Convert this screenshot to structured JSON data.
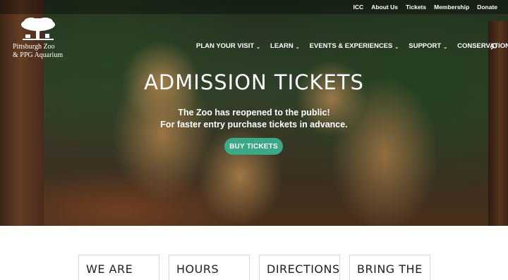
{
  "topbar": {
    "links": [
      "ICC",
      "About Us",
      "Tickets",
      "Membership",
      "Donate"
    ]
  },
  "logo": {
    "line1": "Pittsburgh Zoo",
    "line2": "& PPG Aquarium",
    "icon": "tree-logo-icon"
  },
  "nav": {
    "items": [
      {
        "label": "PLAN YOUR VISIT",
        "dropdown": true
      },
      {
        "label": "LEARN",
        "dropdown": true
      },
      {
        "label": "EVENTS & EXPERIENCES",
        "dropdown": true
      },
      {
        "label": "SUPPORT",
        "dropdown": true
      },
      {
        "label": "CONSERVATION",
        "dropdown": false
      }
    ],
    "search_icon": "search-icon"
  },
  "hero": {
    "title": "ADMISSION TICKETS",
    "line1": "The Zoo has reopened to the public!",
    "line2": "For faster entry purchase tickets in advance.",
    "button": "BUY TICKETS"
  },
  "cards": [
    "WE ARE",
    "HOURS",
    "DIRECTIONS",
    "BRING THE"
  ],
  "colors": {
    "accent": "#3aa986",
    "text_white": "#ffffff",
    "card_text": "#222222"
  }
}
